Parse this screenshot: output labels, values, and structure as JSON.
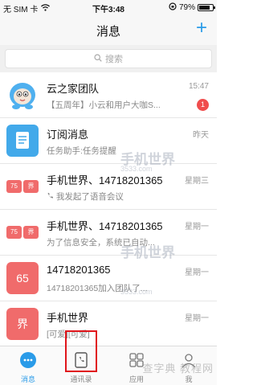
{
  "status_bar": {
    "carrier": "无 SIM 卡",
    "time": "下午3:48",
    "battery": "79%",
    "battery_level": 0.79
  },
  "nav": {
    "title": "消息",
    "add_label": "+"
  },
  "search": {
    "placeholder": "搜索"
  },
  "conversations": [
    {
      "name": "云之家团队",
      "preview": "【五周年】小云和用户大咖S...",
      "date": "15:47",
      "badge": "1"
    },
    {
      "name": "订阅消息",
      "preview": "任务助手:任务提醒",
      "date": "昨天"
    },
    {
      "name": "手机世界、14718201365",
      "preview": "我发起了语音会议",
      "date": "星期三",
      "avatar_tags": [
        "75",
        "界"
      ]
    },
    {
      "name": "手机世界、14718201365",
      "preview": "为了信息安全，系统已自动...",
      "date": "星期一",
      "avatar_tags": [
        "75",
        "界"
      ]
    },
    {
      "name": "14718201365",
      "preview": "14718201365加入团队了...",
      "date": "星期一",
      "avatar_text": "65"
    },
    {
      "name": "手机世界",
      "preview": "[可爱][可爱]",
      "date": "星期一",
      "avatar_text": "界"
    }
  ],
  "tabs": [
    {
      "label": "消息"
    },
    {
      "label": "通讯录"
    },
    {
      "label": "应用"
    },
    {
      "label": "我"
    }
  ],
  "watermarks": [
    "手机世界",
    "3533.com",
    "查字典 教程网"
  ],
  "colors": {
    "accent": "#2a9be8",
    "badge": "#f04d4d",
    "avatar_red": "#f06b6b",
    "avatar_blue": "#42a9ea",
    "highlight": "#e0151b"
  }
}
